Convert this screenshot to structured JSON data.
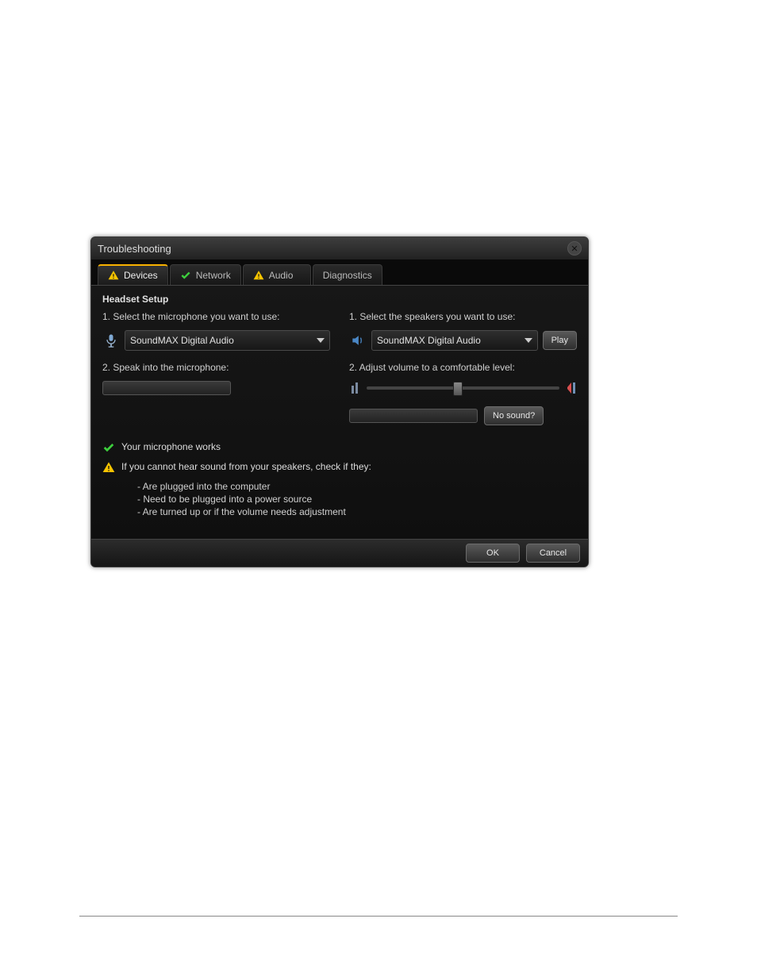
{
  "titlebar": {
    "title": "Troubleshooting"
  },
  "tabs": {
    "devices": "Devices",
    "network": "Network",
    "audio": "Audio",
    "diagnostics": "Diagnostics"
  },
  "content": {
    "section_title": "Headset Setup",
    "mic": {
      "step1": "1. Select the microphone you want to use:",
      "selected": "SoundMAX Digital Audio",
      "step2": "2. Speak into the microphone:"
    },
    "speakers": {
      "step1": "1. Select the speakers you want to use:",
      "selected": "SoundMAX Digital Audio",
      "play": "Play",
      "step2": "2. Adjust volume to a comfortable level:",
      "nosound": "No sound?"
    }
  },
  "status": {
    "mic_ok": "Your microphone works",
    "spk_warn": "If you cannot hear sound from your speakers, check if they:",
    "bullets": [
      "- Are plugged into the computer",
      "- Need to be plugged into a power source",
      "- Are turned up or if the volume needs adjustment"
    ]
  },
  "footer": {
    "ok": "OK",
    "cancel": "Cancel"
  }
}
